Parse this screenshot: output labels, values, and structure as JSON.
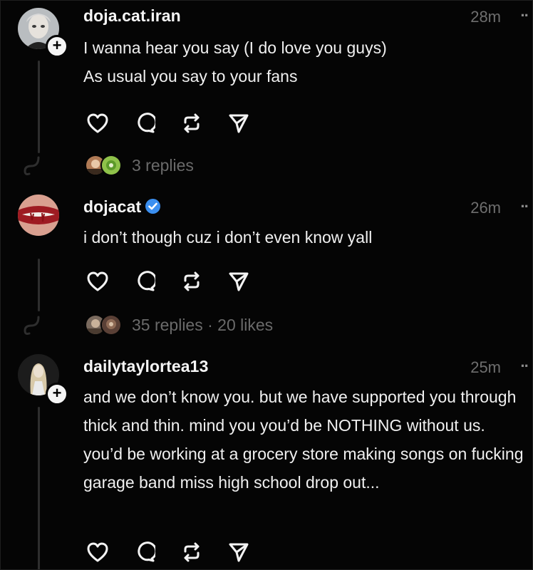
{
  "posts": [
    {
      "username": "doja.cat.iran",
      "time": "28m",
      "more": "··",
      "text": "I wanna hear you say (I do love you guys)\nAs usual you say to your fans",
      "replies": "3 replies",
      "verified": false
    },
    {
      "username": "dojacat",
      "time": "26m",
      "more": "··",
      "text": "i don’t though cuz i don’t even know yall",
      "replies": "35 replies · 20 likes",
      "verified": true
    },
    {
      "username": "dailytaylortea13",
      "time": "25m",
      "more": "··",
      "text": "and we don’t know you. but we have supported you through thick and thin. mind you you’d be NOTHING without us. you’d be working at a grocery store making songs on fucking garage band miss high school drop out...",
      "verified": false
    }
  ],
  "follow_badge": "+",
  "icons": [
    "heart-icon",
    "comment-icon",
    "repost-icon",
    "share-icon"
  ],
  "colors": {
    "background": "#050505",
    "text": "#f0f0f0",
    "muted": "#6e6e6e",
    "verified": "#3b8ff0"
  }
}
